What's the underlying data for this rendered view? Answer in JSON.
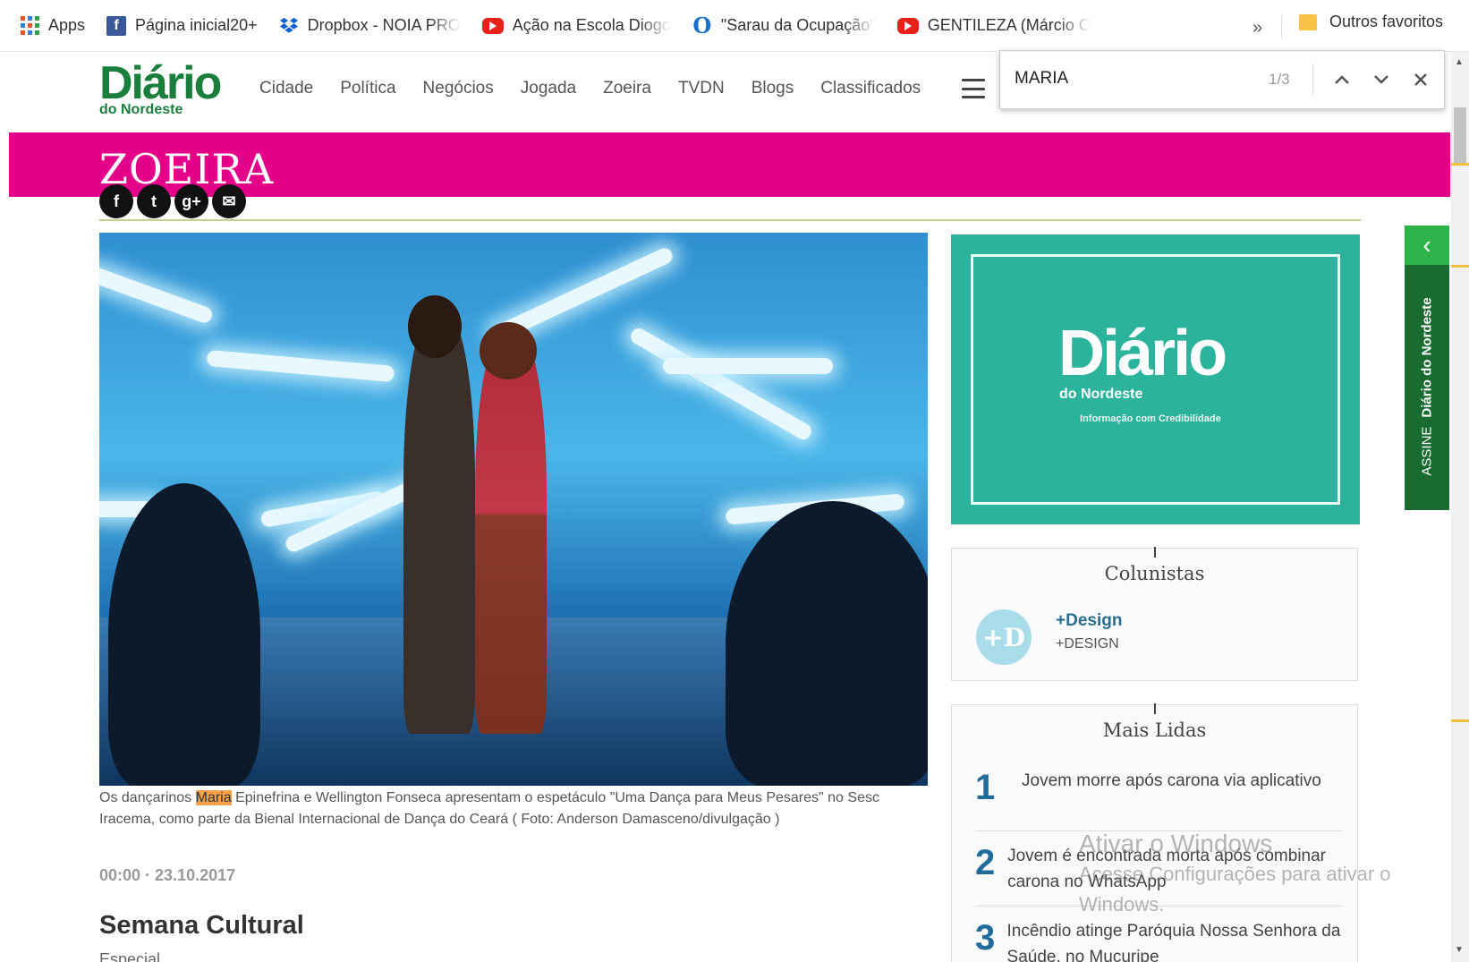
{
  "bookmarks": {
    "items": [
      {
        "label": "Apps",
        "icon": "apps-grid-icon"
      },
      {
        "label": "Página inicial20+",
        "icon": "facebook-icon"
      },
      {
        "label": "Dropbox - NOIA PRO",
        "icon": "dropbox-icon"
      },
      {
        "label": "Ação na Escola Diogo",
        "icon": "youtube-icon"
      },
      {
        "label": "\"Sarau da Ocupação\"",
        "icon": "opera-icon"
      },
      {
        "label": "GENTILEZA (Márcio C",
        "icon": "youtube-icon"
      }
    ],
    "more": "»",
    "other": "Outros favoritos"
  },
  "site": {
    "logo_main": "Diário",
    "logo_sub": "do Nordeste",
    "nav": [
      "Cidade",
      "Política",
      "Negócios",
      "Jogada",
      "Zoeira",
      "TVDN",
      "Blogs",
      "Classificados"
    ]
  },
  "findbar": {
    "query": "MARIA",
    "count": "1/3"
  },
  "section": {
    "title": "ZOEIRA"
  },
  "social": [
    "f",
    "t",
    "g+",
    "✉"
  ],
  "article": {
    "caption_pre": "Os dançarinos ",
    "caption_highlight": "Maria",
    "caption_post": " Epinefrina e Wellington Fonseca apresentam o espetáculo \"Uma Dança para Meus Pesares\" no Sesc Iracema, como parte da Bienal Internacional de Dança do Ceará ( Foto: Anderson Damasceno/divulgação )",
    "dateline": "00:00 · 23.10.2017",
    "headline": "Semana Cultural",
    "kicker": "Especial"
  },
  "ad": {
    "logo": "Diário",
    "sub": "do Nordeste",
    "tagline": "Informação com Credibilidade",
    "color": "#2bb39b"
  },
  "colunistas": {
    "title": "Colunistas",
    "avatar": "+D",
    "name": "+Design",
    "sub": "+DESIGN"
  },
  "mais_lidas": {
    "title": "Mais Lidas",
    "items": [
      {
        "num": "1",
        "text": "Jovem morre após carona via aplicativo"
      },
      {
        "num": "2",
        "text": "Jovem é encontrada morta após combinar carona no WhatsApp"
      },
      {
        "num": "3",
        "text": "Incêndio atinge Paróquia Nossa Senhora da Saúde, no Mucuripe"
      }
    ]
  },
  "assine": {
    "label": "ASSINE",
    "brand": "Diário do Nordeste"
  },
  "watermark": {
    "line1": "Ativar o Windows",
    "line2": "Acesse Configurações para ativar o",
    "line3": "Windows."
  },
  "colors": {
    "section_banner": "#e5008a",
    "brand_green": "#1a7e3c",
    "highlight": "#f7a24a"
  }
}
